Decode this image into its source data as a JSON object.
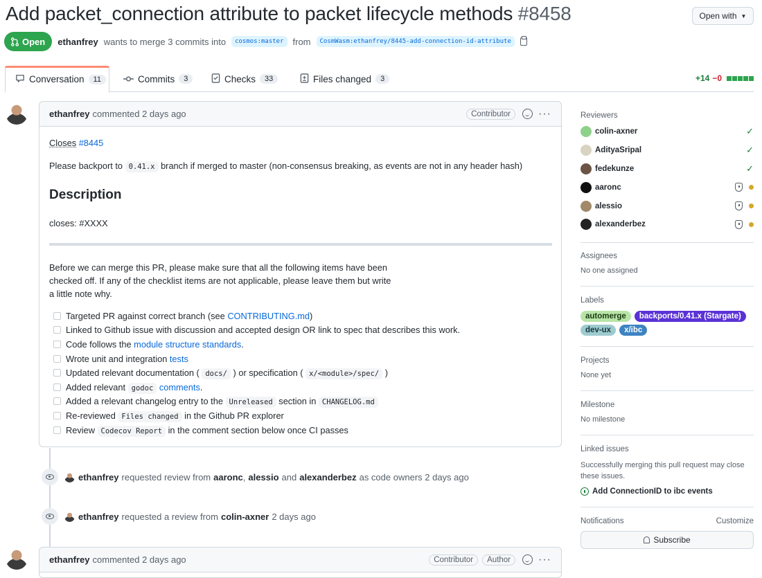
{
  "pr": {
    "title": "Add packet_connection attribute to packet lifecycle methods",
    "number": "#8458",
    "open_with_label": "Open with",
    "state": "Open",
    "author": "ethanfrey",
    "merge_text": "wants to merge 3 commits into",
    "base_branch": "cosmos:master",
    "from_text": "from",
    "head_branch": "CosmWasm:ethanfrey/8445-add-connection-id-attribute"
  },
  "tabs": [
    {
      "label": "Conversation",
      "count": "11",
      "icon": "comment-icon"
    },
    {
      "label": "Commits",
      "count": "3",
      "icon": "commit-icon"
    },
    {
      "label": "Checks",
      "count": "33",
      "icon": "checklist-icon"
    },
    {
      "label": "Files changed",
      "count": "3",
      "icon": "file-diff-icon"
    }
  ],
  "diffstat": {
    "additions": "+14",
    "deletions": "−0"
  },
  "comment1": {
    "author": "ethanfrey",
    "action": "commented 2 days ago",
    "role": "Contributor",
    "closes_word": "Closes",
    "closes_issue": "#8445",
    "backport_pre": "Please backport to",
    "backport_code": "0.41.x",
    "backport_post": "branch if merged to master (non-consensus breaking, as events are not in any header hash)",
    "heading": "Description",
    "closes_placeholder": "closes: #XXXX",
    "intro": "Before we can merge this PR, please make sure that all the following items have been checked off. If any of the checklist items are not applicable, please leave them but write a little note why.",
    "checklist": [
      {
        "pre": "Targeted PR against correct branch (see ",
        "link": "CONTRIBUTING.md",
        "post": ")"
      },
      {
        "pre": "Linked to Github issue with discussion and accepted design OR link to spec that describes this work."
      },
      {
        "pre": "Code follows the ",
        "link": "module structure standards",
        "post": "."
      },
      {
        "pre": "Wrote unit and integration ",
        "link": "tests"
      },
      {
        "pre": "Updated relevant documentation ( ",
        "code": "docs/",
        "mid": " ) or specification ( ",
        "code2": "x/<module>/spec/",
        "post": " )"
      },
      {
        "pre": "Added relevant ",
        "code": "godoc",
        "link": " comments",
        "post": "."
      },
      {
        "pre": "Added a relevant changelog entry to the ",
        "code": "Unreleased",
        "mid": " section in ",
        "code2": "CHANGELOG.md"
      },
      {
        "pre": "Re-reviewed ",
        "code": "Files changed",
        "post": " in the Github PR explorer"
      },
      {
        "pre": "Review ",
        "code": "Codecov Report",
        "post": " in the comment section below once CI passes"
      }
    ]
  },
  "events": [
    {
      "actor": "ethanfrey",
      "text1": "requested review from",
      "u1": "aaronc",
      "sep1": ",",
      "u2": "alessio",
      "sep2": "and",
      "u3": "alexanderbez",
      "text2": "as code owners 2 days ago"
    },
    {
      "actor": "ethanfrey",
      "text1": "requested a review from",
      "u1": "colin-axner",
      "text2": "2 days ago"
    }
  ],
  "comment2": {
    "author": "ethanfrey",
    "action": "commented 2 days ago",
    "role1": "Contributor",
    "role2": "Author"
  },
  "sidebar": {
    "reviewers_title": "Reviewers",
    "reviewers": [
      {
        "name": "colin-axner",
        "status": "approved",
        "avatar_color": "#8fd18a"
      },
      {
        "name": "AdityaSripal",
        "status": "approved",
        "avatar_color": "#d9d3c2"
      },
      {
        "name": "fedekunze",
        "status": "approved",
        "avatar_color": "#6b5345"
      },
      {
        "name": "aaronc",
        "status": "pending",
        "avatar_color": "#111111"
      },
      {
        "name": "alessio",
        "status": "pending",
        "avatar_color": "#a08a6a"
      },
      {
        "name": "alexanderbez",
        "status": "pending",
        "avatar_color": "#222222"
      }
    ],
    "assignees_title": "Assignees",
    "assignees_text": "No one assigned",
    "labels_title": "Labels",
    "labels": [
      {
        "name": "automerge",
        "bg": "#b7e5a8",
        "fg": "#1b3a12"
      },
      {
        "name": "backports/0.41.x (Stargate)",
        "bg": "#5a32d6",
        "fg": "#ffffff"
      },
      {
        "name": "dev-ux",
        "bg": "#9ecbd0",
        "fg": "#17373a"
      },
      {
        "name": "x/ibc",
        "bg": "#3d83c2",
        "fg": "#ffffff"
      }
    ],
    "projects_title": "Projects",
    "projects_text": "None yet",
    "milestone_title": "Milestone",
    "milestone_text": "No milestone",
    "linked_title": "Linked issues",
    "linked_text": "Successfully merging this pull request may close these issues.",
    "linked_issue": "Add ConnectionID to ibc events",
    "notifications_title": "Notifications",
    "customize": "Customize",
    "subscribe": "Subscribe"
  }
}
